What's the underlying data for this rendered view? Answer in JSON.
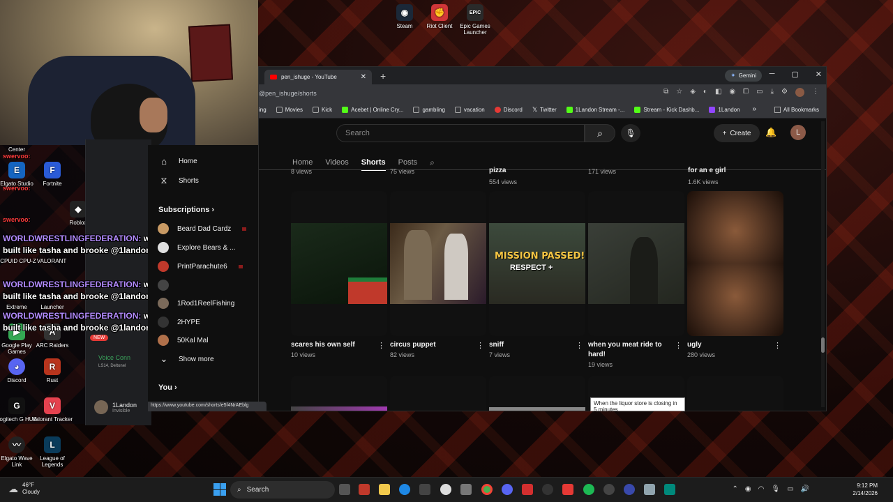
{
  "desktop": {
    "top_icons": [
      {
        "label": "Steam",
        "color": "#1b2838"
      },
      {
        "label": "Riot Client",
        "color": "#d13639"
      },
      {
        "label": "Epic Games Launcher",
        "color": "#2a2a2a"
      }
    ],
    "left_icons": [
      {
        "label": "Center"
      },
      {
        "label": "Elgato Studio"
      },
      {
        "label": "Fortnite"
      },
      {
        "label": "Roblox"
      },
      {
        "label": "CPUID CPU-Z"
      },
      {
        "label": "VALORANT"
      },
      {
        "label": "Extreme"
      },
      {
        "label": "Launcher"
      },
      {
        "label": "Google Play Games"
      },
      {
        "label": "ARC Raiders"
      },
      {
        "label": "Discord"
      },
      {
        "label": "Rust"
      },
      {
        "label": "Logitech G HUB"
      },
      {
        "label": "Valorant Tracker"
      },
      {
        "label": "Elgato Wave Link"
      },
      {
        "label": "League of Legends"
      }
    ]
  },
  "chat": {
    "username": "WORLDWRESTLINGFEDERATION:",
    "message": "why do u only talk to girls built like tasha and brooke @1landon",
    "swervoo": "swervoo:"
  },
  "browser": {
    "tab_title": "pen_ishuge - YouTube",
    "gemini_label": "Gemini",
    "url": "@pen_ishuge/shorts",
    "bookmarks": [
      {
        "label": "ing",
        "color": "#777"
      },
      {
        "label": "Movies",
        "color": "#999"
      },
      {
        "label": "Kick",
        "color": "#999"
      },
      {
        "label": "Acebet | Online Cry...",
        "color": "#53fc18"
      },
      {
        "label": "gambling",
        "color": "#999"
      },
      {
        "label": "vacation",
        "color": "#999"
      },
      {
        "label": "Discord",
        "color": "#e53935"
      },
      {
        "label": "Twitter",
        "color": "#fff"
      },
      {
        "label": "1Landon Stream -...",
        "color": "#53fc18"
      },
      {
        "label": "Stream - Kick Dashb...",
        "color": "#53fc18"
      },
      {
        "label": "1Landon",
        "color": "#9146ff"
      }
    ],
    "bookmarks_more": "»",
    "all_bookmarks": "All Bookmarks",
    "status_url": "https://www.youtube.com/shorts/e5f4NrAEblg"
  },
  "youtube": {
    "search_placeholder": "Search",
    "create_label": "Create",
    "avatar_letter": "L",
    "channel_tabs": [
      "Home",
      "Videos",
      "Shorts",
      "Posts"
    ],
    "previous_row": [
      {
        "title": "",
        "views": "8 views"
      },
      {
        "title": "",
        "views": "75 views"
      },
      {
        "title": "pizza",
        "views": "554 views"
      },
      {
        "title": "",
        "views": "171 views"
      },
      {
        "title": "for an e girl",
        "views": "1.6K views"
      }
    ],
    "shorts": [
      {
        "title": "scares his own self",
        "views": "10 views"
      },
      {
        "title": "circus puppet",
        "views": "82 views"
      },
      {
        "title": "sniff",
        "views": "7 views"
      },
      {
        "title": "when you meat ride to hard!",
        "views": "19 views"
      },
      {
        "title": "ugly",
        "views": "280 views"
      }
    ],
    "thumb_text": {
      "line1": "MISSION PASSED!",
      "line2": "RESPECT +"
    },
    "tooltip": "When the liquor store is closing in 5 minutes",
    "guide": {
      "home": "Home",
      "shorts": "Shorts",
      "subscriptions": "Subscriptions",
      "subs": [
        {
          "name": "Beard Dad Cardz",
          "color": "#c89a64"
        },
        {
          "name": "Explore Bears & ...",
          "color": "#e0e0e0"
        },
        {
          "name": "PrintParachute6",
          "color": "#c0392b"
        },
        {
          "name": "",
          "color": "#444"
        },
        {
          "name": "1Rod1ReelFishing",
          "color": "#7b6a5a"
        },
        {
          "name": "2HYPE",
          "color": "#333"
        },
        {
          "name": "50Kal Mal",
          "color": "#b0704a"
        }
      ],
      "show_more": "Show more",
      "you": "You"
    }
  },
  "discord": {
    "voice_label": "Voice Conn",
    "voice_sub": "LS14, Deltonel",
    "username": "1Landon",
    "status": "Invisible",
    "new_badge": "NEW"
  },
  "taskbar": {
    "temp": "46°F",
    "weather": "Cloudy",
    "search": "Search",
    "time": "9:12 PM",
    "date": "2/14/2026"
  }
}
